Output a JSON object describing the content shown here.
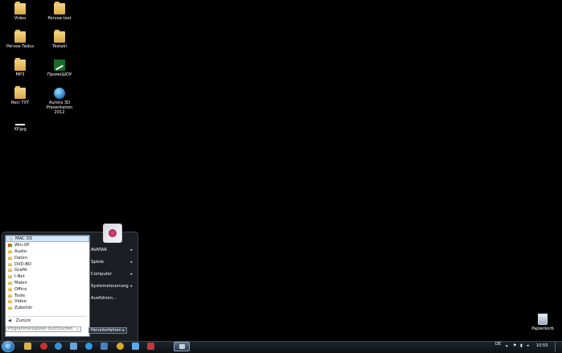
{
  "desktop": {
    "icons": [
      {
        "label": "Video",
        "type": "folder"
      },
      {
        "label": "Pervoe test",
        "type": "folder"
      },
      {
        "label": "Pervoe Tadus",
        "type": "folder"
      },
      {
        "label": "Testaki",
        "type": "folder"
      },
      {
        "label": "MP3",
        "type": "folder"
      },
      {
        "label": "ПромоШОУ",
        "type": "chart-icon"
      },
      {
        "label": "Reci TXT",
        "type": "folder"
      },
      {
        "label": "Aurora 3D\nPresentation 2012",
        "type": "globe-icon"
      },
      {
        "label": "XP.jpg",
        "type": "image-file"
      }
    ],
    "recycle_bin": {
      "label": "Papierkorb"
    }
  },
  "start_menu": {
    "programs": [
      {
        "label": "MAC OS",
        "icon": "mac-app-icon",
        "selected": true
      },
      {
        "label": "Win-XP",
        "icon": "win-app-icon",
        "selected": false
      },
      {
        "label": "Audio",
        "icon": "folder-icon"
      },
      {
        "label": "Daten",
        "icon": "folder-icon"
      },
      {
        "label": "DVD-BD",
        "icon": "folder-icon"
      },
      {
        "label": "Grafik",
        "icon": "folder-icon"
      },
      {
        "label": "I-Net",
        "icon": "folder-icon"
      },
      {
        "label": "Malen",
        "icon": "folder-icon"
      },
      {
        "label": "Office",
        "icon": "folder-icon"
      },
      {
        "label": "Tools",
        "icon": "folder-icon"
      },
      {
        "label": "Video",
        "icon": "folder-icon"
      },
      {
        "label": "Zubehör",
        "icon": "folder-icon"
      }
    ],
    "back_label": "Zurück",
    "search_placeholder": "Programme/Dateien durchsuchen",
    "right_items": [
      {
        "label": "AVATAR",
        "has_submenu": true
      },
      {
        "label": "Spiele",
        "has_submenu": true
      },
      {
        "label": "Computer",
        "has_submenu": true
      },
      {
        "label": "Systemsteuerung",
        "has_submenu": true
      },
      {
        "label": "Ausführen...",
        "has_submenu": false
      }
    ],
    "shutdown_label": "Herunterfahren",
    "shutdown_arrow": "▸"
  },
  "taskbar": {
    "language": "DE",
    "clock": "10:55",
    "pinned": [
      {
        "icon": "explorer-icon",
        "color": "#d9b24a"
      },
      {
        "icon": "opera-icon",
        "color": "#c8322a"
      },
      {
        "icon": "ie-icon",
        "color": "#3a8fd6"
      },
      {
        "icon": "media-icon",
        "color": "#6aa3d8"
      },
      {
        "icon": "skype-icon",
        "color": "#2b9be6"
      },
      {
        "icon": "app-icon",
        "color": "#4b7fc0"
      },
      {
        "icon": "chrome-icon",
        "color": "#d9a829"
      },
      {
        "icon": "download-icon",
        "color": "#5aa8e8"
      },
      {
        "icon": "game-icon",
        "color": "#c23a3a"
      }
    ]
  }
}
